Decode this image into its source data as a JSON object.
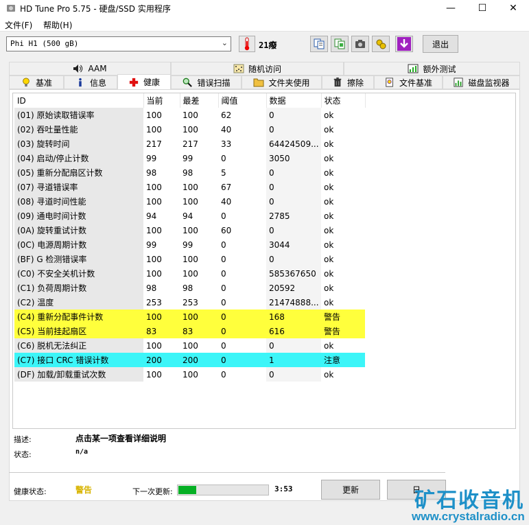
{
  "window": {
    "title": "HD Tune Pro 5.75 - 硬盘/SSD 实用程序",
    "minimize_glyph": "—",
    "maximize_glyph": "☐",
    "close_glyph": "✕"
  },
  "menu": [
    {
      "label": "文件(F)"
    },
    {
      "label": "帮助(H)"
    }
  ],
  "toolbar": {
    "drive": "Phi      H1 (500 gB)",
    "temperature": "21癈",
    "exit_label": "退出",
    "buttons": [
      "copy-text-icon",
      "copy-info-icon",
      "screenshot-camera-icon",
      "options-icon",
      "download-arrow-icon"
    ]
  },
  "tabs_top": [
    {
      "label": "AAM",
      "icon": "speaker-icon"
    },
    {
      "label": "随机访问",
      "icon": "random-access-icon"
    },
    {
      "label": "额外测试",
      "icon": "extra-tests-icon"
    }
  ],
  "tabs": [
    {
      "label": "基准",
      "icon": "benchmark-bulb-icon"
    },
    {
      "label": "信息",
      "icon": "info-icon"
    },
    {
      "label": "健康",
      "icon": "health-cross-icon",
      "active": true
    },
    {
      "label": "错误扫描",
      "icon": "magnifier-icon"
    },
    {
      "label": "文件夹使用",
      "icon": "folder-icon"
    },
    {
      "label": "擦除",
      "icon": "trash-icon"
    },
    {
      "label": "文件基准",
      "icon": "file-benchmark-icon"
    },
    {
      "label": "磁盘监视器",
      "icon": "disk-monitor-icon"
    }
  ],
  "table": {
    "headers": [
      "ID",
      "当前",
      "最差",
      "阈值",
      "数据",
      "状态"
    ],
    "rows": [
      {
        "id": "(01) 原始读取错误率",
        "current": "100",
        "worst": "100",
        "threshold": "62",
        "data": "0",
        "status": "ok",
        "level": "ok"
      },
      {
        "id": "(02) 吞吐量性能",
        "current": "100",
        "worst": "100",
        "threshold": "40",
        "data": "0",
        "status": "ok",
        "level": "ok"
      },
      {
        "id": "(03) 旋转时间",
        "current": "217",
        "worst": "217",
        "threshold": "33",
        "data": "64424509...",
        "status": "ok",
        "level": "ok"
      },
      {
        "id": "(04) 启动/停止计数",
        "current": "99",
        "worst": "99",
        "threshold": "0",
        "data": "3050",
        "status": "ok",
        "level": "ok"
      },
      {
        "id": "(05) 重新分配扇区计数",
        "current": "98",
        "worst": "98",
        "threshold": "5",
        "data": "0",
        "status": "ok",
        "level": "ok"
      },
      {
        "id": "(07) 寻道错误率",
        "current": "100",
        "worst": "100",
        "threshold": "67",
        "data": "0",
        "status": "ok",
        "level": "ok"
      },
      {
        "id": "(08) 寻道时间性能",
        "current": "100",
        "worst": "100",
        "threshold": "40",
        "data": "0",
        "status": "ok",
        "level": "ok"
      },
      {
        "id": "(09) 通电时间计数",
        "current": "94",
        "worst": "94",
        "threshold": "0",
        "data": "2785",
        "status": "ok",
        "level": "ok"
      },
      {
        "id": "(0A) 旋转重试计数",
        "current": "100",
        "worst": "100",
        "threshold": "60",
        "data": "0",
        "status": "ok",
        "level": "ok"
      },
      {
        "id": "(0C) 电源周期计数",
        "current": "99",
        "worst": "99",
        "threshold": "0",
        "data": "3044",
        "status": "ok",
        "level": "ok"
      },
      {
        "id": "(BF) G 检测错误率",
        "current": "100",
        "worst": "100",
        "threshold": "0",
        "data": "0",
        "status": "ok",
        "level": "ok"
      },
      {
        "id": "(C0) 不安全关机计数",
        "current": "100",
        "worst": "100",
        "threshold": "0",
        "data": "585367650",
        "status": "ok",
        "level": "ok"
      },
      {
        "id": "(C1) 负荷周期计数",
        "current": "98",
        "worst": "98",
        "threshold": "0",
        "data": "20592",
        "status": "ok",
        "level": "ok"
      },
      {
        "id": "(C2) 温度",
        "current": "253",
        "worst": "253",
        "threshold": "0",
        "data": "21474888...",
        "status": "ok",
        "level": "ok"
      },
      {
        "id": "(C4) 重新分配事件计数",
        "current": "100",
        "worst": "100",
        "threshold": "0",
        "data": "168",
        "status": "警告",
        "level": "warn"
      },
      {
        "id": "(C5) 当前挂起扇区",
        "current": "83",
        "worst": "83",
        "threshold": "0",
        "data": "616",
        "status": "警告",
        "level": "warn"
      },
      {
        "id": "(C6) 脱机无法纠正",
        "current": "100",
        "worst": "100",
        "threshold": "0",
        "data": "0",
        "status": "ok",
        "level": "ok"
      },
      {
        "id": "(C7) 接口 CRC 错误计数",
        "current": "200",
        "worst": "200",
        "threshold": "0",
        "data": "1",
        "status": "注意",
        "level": "caution"
      },
      {
        "id": "(DF) 加载/卸载重试次数",
        "current": "100",
        "worst": "100",
        "threshold": "0",
        "data": "0",
        "status": "ok",
        "level": "ok"
      }
    ]
  },
  "info": {
    "desc_label": "描述:",
    "desc_value": "点击某一项查看详细说明",
    "status_label": "状态:",
    "status_value": "n/a"
  },
  "footer": {
    "health_label": "健康状态:",
    "health_value": "警告",
    "next_update_label": "下一次更新:",
    "progress_fraction": 0.2,
    "countdown": "3:53",
    "update_button": "更新",
    "second_button": "日"
  },
  "watermark": {
    "cn": "矿石收音机",
    "url": "www.crystalradio.cn"
  },
  "colors": {
    "warn_row": "#ffff3c",
    "caution_row": "#3cf5f8",
    "health_warn_text": "#d8b400",
    "progress_fill": "#06b025",
    "watermark": "#1e90c8"
  }
}
